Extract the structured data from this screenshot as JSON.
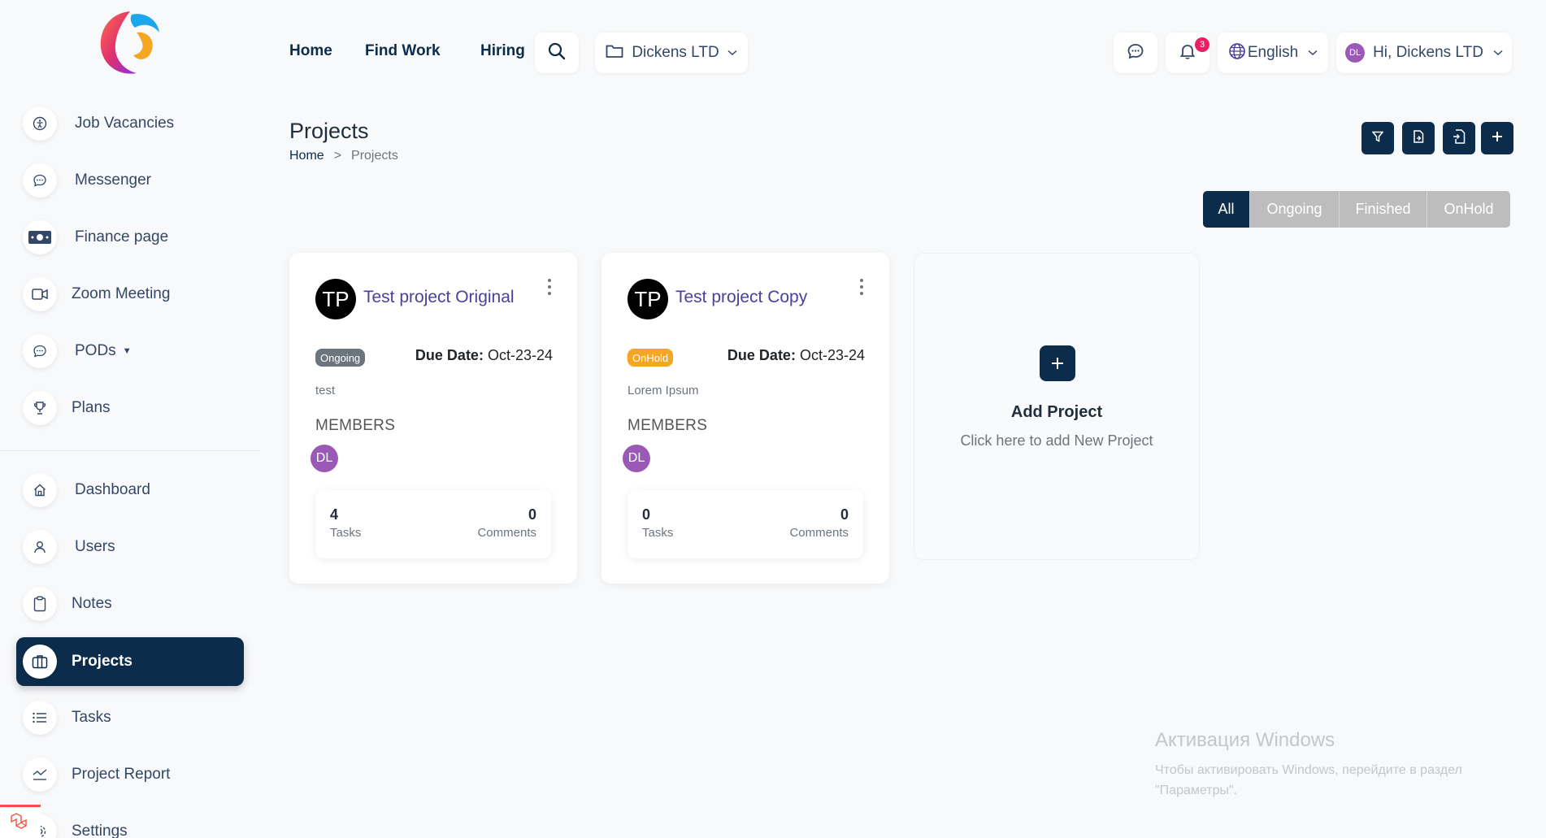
{
  "nav": {
    "home": "Home",
    "find_work": "Find Work",
    "hiring": "Hiring",
    "workspace": "Dickens LTD",
    "notifications_count": "3",
    "language": "English",
    "user_initials": "DL",
    "greeting": "Hi, Dickens LTD"
  },
  "sidebar": {
    "top_items": [
      {
        "label": "Job Vacancies",
        "icon": "accessibility-icon"
      },
      {
        "label": "Messenger",
        "icon": "chat-icon"
      },
      {
        "label": "Finance page",
        "icon": "money-icon"
      },
      {
        "label": "Zoom Meeting",
        "icon": "video-icon"
      },
      {
        "label": "PODs",
        "icon": "chat-icon"
      },
      {
        "label": "Plans",
        "icon": "trophy-icon"
      }
    ],
    "bottom_items": [
      {
        "label": "Dashboard",
        "icon": "home-icon"
      },
      {
        "label": "Users",
        "icon": "user-icon"
      },
      {
        "label": "Notes",
        "icon": "clipboard-icon"
      },
      {
        "label": "Projects",
        "icon": "projects-icon",
        "active": true
      },
      {
        "label": "Tasks",
        "icon": "list-icon"
      },
      {
        "label": "Project Report",
        "icon": "chart-line-icon"
      },
      {
        "label": "Settings",
        "icon": "gear-icon"
      }
    ]
  },
  "page": {
    "title": "Projects",
    "breadcrumb_home": "Home",
    "breadcrumb_separator": ">",
    "breadcrumb_current": "Projects"
  },
  "filters": [
    "All",
    "Ongoing",
    "Finished",
    "OnHold"
  ],
  "projects": [
    {
      "initials": "TP",
      "name": "Test project Original",
      "status": "Ongoing",
      "status_color": "#6c757d",
      "due_label": "Due Date:",
      "due_date": "Oct-23-24",
      "description": "test",
      "members_label": "MEMBERS",
      "member_initials": "DL",
      "tasks_count": "4",
      "tasks_label": "Tasks",
      "comments_count": "0",
      "comments_label": "Comments"
    },
    {
      "initials": "TP",
      "name": "Test project Copy",
      "status": "OnHold",
      "status_color": "#f5a623",
      "due_label": "Due Date:",
      "due_date": "Oct-23-24",
      "description": "Lorem Ipsum",
      "members_label": "MEMBERS",
      "member_initials": "DL",
      "tasks_count": "0",
      "tasks_label": "Tasks",
      "comments_count": "0",
      "comments_label": "Comments"
    }
  ],
  "add_project": {
    "title": "Add Project",
    "subtitle": "Click here to add New Project"
  },
  "watermark": {
    "line1": "Активация Windows",
    "line2": "Чтобы активировать Windows, перейдите в раздел \"Параметры\"."
  },
  "colors": {
    "primary": "#0b2c4a",
    "accent_name": "#4a3f9f",
    "badge": "#e91e63",
    "avatar": "#9b59b6"
  }
}
